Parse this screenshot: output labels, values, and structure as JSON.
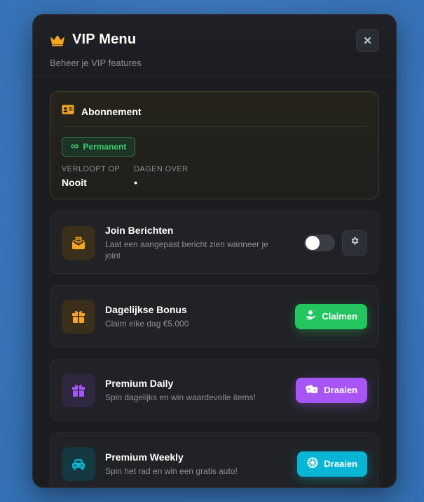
{
  "modal": {
    "title": "VIP Menu",
    "subtitle": "Beheer je VIP features",
    "close_label": "✕"
  },
  "subscription": {
    "title": "Abonnement",
    "badge_icon": "∞",
    "badge": "Permanent",
    "expires_label": "VERLOOPT OP",
    "expires_value": "Nooit",
    "days_label": "DAGEN OVER",
    "days_value": "•"
  },
  "features": [
    {
      "name": "Join Berichten",
      "desc": "Laat een aangepast bericht zien wanneer je joint",
      "icon": "envelope-icon",
      "toggle_on": false
    },
    {
      "name": "Dagelijkse Bonus",
      "desc": "Claim elke dag €5.000",
      "icon": "gift-icon",
      "button": "Claimen",
      "button_icon": "hand-coin-icon"
    },
    {
      "name": "Premium Daily",
      "desc": "Spin dagelijks en win waardevolle items!",
      "icon": "gift-icon",
      "button": "Draaien",
      "button_icon": "dice-icon"
    },
    {
      "name": "Premium Weekly",
      "desc": "Spin het rad en win een gratis auto!",
      "icon": "car-icon",
      "button": "Draaien",
      "button_icon": "wheel-icon"
    }
  ],
  "colors": {
    "gold": "#f5a623",
    "green": "#22c55e",
    "purple": "#a855f7",
    "cyan": "#06b6d4"
  }
}
